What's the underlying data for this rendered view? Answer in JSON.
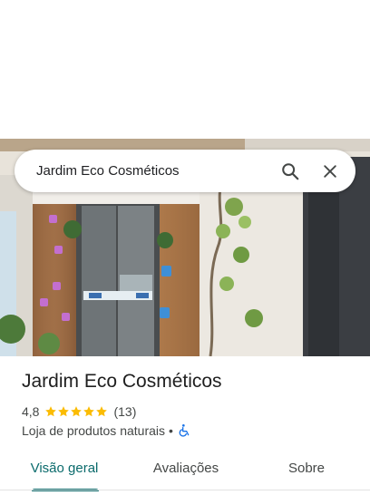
{
  "search": {
    "query": "Jardim Eco Cosméticos"
  },
  "place": {
    "name": "Jardim Eco Cosméticos",
    "rating": "4,8",
    "rating_value": 4.8,
    "review_count": "(13)",
    "category": "Loja de produtos naturais",
    "separator": "•"
  },
  "tabs": [
    {
      "label": "Visão geral",
      "active": true
    },
    {
      "label": "Avaliações",
      "active": false
    },
    {
      "label": "Sobre",
      "active": false
    }
  ],
  "colors": {
    "accent": "#0b6b6c",
    "star": "#fbbc04",
    "accessibility": "#1a73e8"
  },
  "icons": {
    "search": "search-icon",
    "close": "close-icon",
    "accessibility": "wheelchair-icon"
  }
}
